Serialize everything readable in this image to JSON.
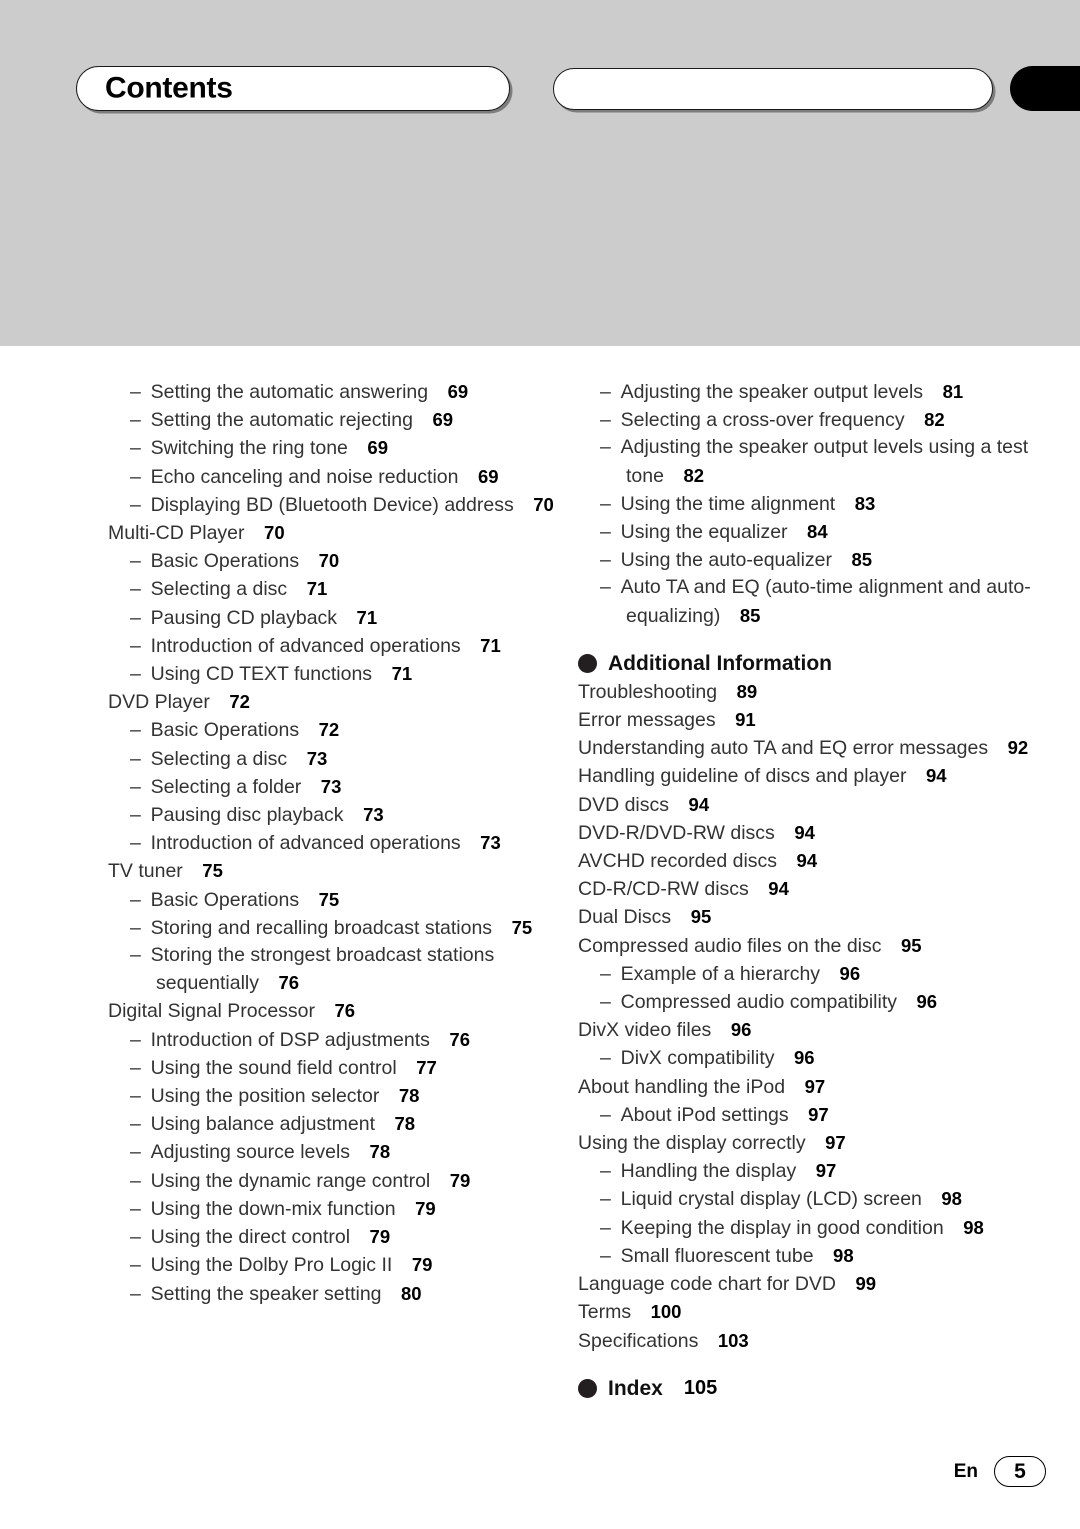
{
  "header": {
    "title": "Contents",
    "secondary_tab_label": "",
    "black_tab_label": ""
  },
  "footer": {
    "language": "En",
    "page_number": "5"
  },
  "colors": {
    "header_band": "#cccccc",
    "tab_fill": "#ffffff",
    "tab_border": "#1a1a1a",
    "black_tab": "#000000",
    "text": "#333333",
    "page_num_text": "#000000"
  },
  "left_column": {
    "entries": [
      {
        "level": 1,
        "dash": "–",
        "label": "Setting the automatic answering",
        "page": "69"
      },
      {
        "level": 1,
        "dash": "–",
        "label": "Setting the automatic rejecting",
        "page": "69"
      },
      {
        "level": 1,
        "dash": "–",
        "label": "Switching the ring tone",
        "page": "69"
      },
      {
        "level": 1,
        "dash": "–",
        "label": "Echo canceling and noise reduction",
        "page": "69"
      },
      {
        "level": 1,
        "dash": "–",
        "label": "Displaying BD (Bluetooth Device) address",
        "page": "70"
      },
      {
        "level": 0,
        "dash": "",
        "label": "Multi-CD Player",
        "page": "70"
      },
      {
        "level": 1,
        "dash": "–",
        "label": "Basic Operations",
        "page": "70"
      },
      {
        "level": 1,
        "dash": "–",
        "label": "Selecting a disc",
        "page": "71"
      },
      {
        "level": 1,
        "dash": "–",
        "label": "Pausing CD playback",
        "page": "71"
      },
      {
        "level": 1,
        "dash": "–",
        "label": "Introduction of advanced operations",
        "page": "71"
      },
      {
        "level": 1,
        "dash": "–",
        "label": "Using CD TEXT functions",
        "page": "71"
      },
      {
        "level": 0,
        "dash": "",
        "label": "DVD Player",
        "page": "72"
      },
      {
        "level": 1,
        "dash": "–",
        "label": "Basic Operations",
        "page": "72"
      },
      {
        "level": 1,
        "dash": "–",
        "label": "Selecting a disc",
        "page": "73"
      },
      {
        "level": 1,
        "dash": "–",
        "label": "Selecting a folder",
        "page": "73"
      },
      {
        "level": 1,
        "dash": "–",
        "label": "Pausing disc playback",
        "page": "73"
      },
      {
        "level": 1,
        "dash": "–",
        "label": "Introduction of advanced operations",
        "page": "73"
      },
      {
        "level": 0,
        "dash": "",
        "label": "TV tuner",
        "page": "75"
      },
      {
        "level": 1,
        "dash": "–",
        "label": "Basic Operations",
        "page": "75"
      },
      {
        "level": 1,
        "dash": "–",
        "label": "Storing and recalling broadcast stations",
        "page": "75"
      },
      {
        "level": 1,
        "dash": "–",
        "label": "Storing the strongest broadcast stations sequentially",
        "page": "76"
      },
      {
        "level": 0,
        "dash": "",
        "label": "Digital Signal Processor",
        "page": "76"
      },
      {
        "level": 1,
        "dash": "–",
        "label": "Introduction of DSP adjustments",
        "page": "76"
      },
      {
        "level": 1,
        "dash": "–",
        "label": "Using the sound field control",
        "page": "77"
      },
      {
        "level": 1,
        "dash": "–",
        "label": "Using the position selector",
        "page": "78"
      },
      {
        "level": 1,
        "dash": "–",
        "label": "Using balance adjustment",
        "page": "78"
      },
      {
        "level": 1,
        "dash": "–",
        "label": "Adjusting source levels",
        "page": "78"
      },
      {
        "level": 1,
        "dash": "–",
        "label": "Using the dynamic range control",
        "page": "79"
      },
      {
        "level": 1,
        "dash": "–",
        "label": "Using the down-mix function",
        "page": "79"
      },
      {
        "level": 1,
        "dash": "–",
        "label": "Using the direct control",
        "page": "79"
      },
      {
        "level": 1,
        "dash": "–",
        "label": "Using the Dolby Pro Logic II",
        "page": "79"
      },
      {
        "level": 1,
        "dash": "–",
        "label": "Setting the speaker setting",
        "page": "80"
      }
    ]
  },
  "right_column": {
    "entries_top": [
      {
        "level": 1,
        "dash": "–",
        "label": "Adjusting the speaker output levels",
        "page": "81"
      },
      {
        "level": 1,
        "dash": "–",
        "label": "Selecting a cross-over frequency",
        "page": "82"
      },
      {
        "level": 1,
        "dash": "–",
        "label": "Adjusting the speaker output levels using a test tone",
        "page": "82"
      },
      {
        "level": 1,
        "dash": "–",
        "label": "Using the time alignment",
        "page": "83"
      },
      {
        "level": 1,
        "dash": "–",
        "label": "Using the equalizer",
        "page": "84"
      },
      {
        "level": 1,
        "dash": "–",
        "label": "Using the auto-equalizer",
        "page": "85"
      },
      {
        "level": 1,
        "dash": "–",
        "label": "Auto TA and EQ (auto-time alignment and auto-equalizing)",
        "page": "85"
      }
    ],
    "section_additional_information": {
      "title": "Additional Information",
      "entries": [
        {
          "level": 0,
          "dash": "",
          "label": "Troubleshooting",
          "page": "89"
        },
        {
          "level": 0,
          "dash": "",
          "label": "Error messages",
          "page": "91"
        },
        {
          "level": 0,
          "dash": "",
          "label": "Understanding auto TA and EQ error messages",
          "page": "92"
        },
        {
          "level": 0,
          "dash": "",
          "label": "Handling guideline of discs and player",
          "page": "94"
        },
        {
          "level": 0,
          "dash": "",
          "label": "DVD discs",
          "page": "94"
        },
        {
          "level": 0,
          "dash": "",
          "label": "DVD-R/DVD-RW discs",
          "page": "94"
        },
        {
          "level": 0,
          "dash": "",
          "label": "AVCHD recorded discs",
          "page": "94"
        },
        {
          "level": 0,
          "dash": "",
          "label": "CD-R/CD-RW discs",
          "page": "94"
        },
        {
          "level": 0,
          "dash": "",
          "label": "Dual Discs",
          "page": "95"
        },
        {
          "level": 0,
          "dash": "",
          "label": "Compressed audio files on the disc",
          "page": "95"
        },
        {
          "level": 1,
          "dash": "–",
          "label": "Example of a hierarchy",
          "page": "96"
        },
        {
          "level": 1,
          "dash": "–",
          "label": "Compressed audio compatibility",
          "page": "96"
        },
        {
          "level": 0,
          "dash": "",
          "label": "DivX video files",
          "page": "96"
        },
        {
          "level": 1,
          "dash": "–",
          "label": "DivX compatibility",
          "page": "96"
        },
        {
          "level": 0,
          "dash": "",
          "label": "About handling the iPod",
          "page": "97"
        },
        {
          "level": 1,
          "dash": "–",
          "label": "About iPod settings",
          "page": "97"
        },
        {
          "level": 0,
          "dash": "",
          "label": "Using the display correctly",
          "page": "97"
        },
        {
          "level": 1,
          "dash": "–",
          "label": "Handling the display",
          "page": "97"
        },
        {
          "level": 1,
          "dash": "–",
          "label": "Liquid crystal display (LCD) screen",
          "page": "98"
        },
        {
          "level": 1,
          "dash": "–",
          "label": "Keeping the display in good condition",
          "page": "98"
        },
        {
          "level": 1,
          "dash": "–",
          "label": "Small fluorescent tube",
          "page": "98"
        },
        {
          "level": 0,
          "dash": "",
          "label": "Language code chart for DVD",
          "page": "99"
        },
        {
          "level": 0,
          "dash": "",
          "label": "Terms",
          "page": "100"
        },
        {
          "level": 0,
          "dash": "",
          "label": "Specifications",
          "page": "103"
        }
      ]
    },
    "section_index": {
      "title": "Index",
      "page": "105"
    }
  }
}
